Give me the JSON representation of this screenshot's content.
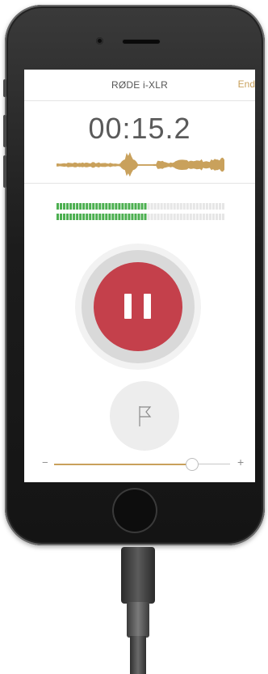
{
  "app": {
    "device_name": "RØDE i-XLR",
    "end_label": "End",
    "timer": "00:15.2"
  },
  "meter": {
    "level_fraction": 0.53,
    "active_color": "#4caf50",
    "inactive_color": "#e6e6e6"
  },
  "waveform": {
    "color": "#c9a15c"
  },
  "record_button": {
    "state": "pause",
    "icon": "pause-icon",
    "color": "#c4404b"
  },
  "marker_button": {
    "icon": "flag-icon"
  },
  "gain_slider": {
    "minus_label": "−",
    "plus_label": "+",
    "value_fraction": 0.82,
    "accent": "#c9a15c"
  }
}
